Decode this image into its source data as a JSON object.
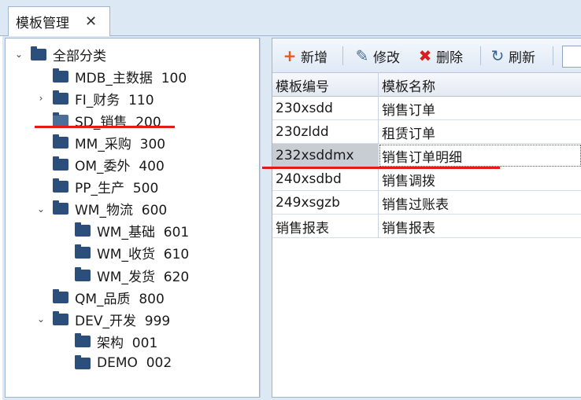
{
  "tab": {
    "label": "模板管理",
    "close": "✕"
  },
  "tree": [
    {
      "label": "全部分类",
      "level": 0,
      "arrow": "⌄",
      "open": false
    },
    {
      "label": "MDB_主数据  100",
      "level": 1,
      "arrow": "",
      "open": false
    },
    {
      "label": "FI_财务  110",
      "level": 1,
      "arrow": "›",
      "open": false
    },
    {
      "label": "SD_销售  200",
      "level": 1,
      "arrow": "",
      "open": true
    },
    {
      "label": "MM_采购  300",
      "level": 1,
      "arrow": "",
      "open": false
    },
    {
      "label": "OM_委外  400",
      "level": 1,
      "arrow": "",
      "open": false
    },
    {
      "label": "PP_生产  500",
      "level": 1,
      "arrow": "",
      "open": false
    },
    {
      "label": "WM_物流  600",
      "level": 1,
      "arrow": "⌄",
      "open": false
    },
    {
      "label": "WM_基础  601",
      "level": 2,
      "arrow": "",
      "open": false
    },
    {
      "label": "WM_收货  610",
      "level": 2,
      "arrow": "",
      "open": false
    },
    {
      "label": "WM_发货  620",
      "level": 2,
      "arrow": "",
      "open": false
    },
    {
      "label": "QM_品质  800",
      "level": 1,
      "arrow": "",
      "open": false
    },
    {
      "label": "DEV_开发  999",
      "level": 1,
      "arrow": "⌄",
      "open": false
    },
    {
      "label": "架构  001",
      "level": 2,
      "arrow": "",
      "open": false
    },
    {
      "label": "DEMO  002",
      "level": 2,
      "arrow": "",
      "open": false
    }
  ],
  "toolbar": {
    "add": "新增",
    "add_icon": "+",
    "edit": "修改",
    "edit_icon": "✎",
    "delete": "删除",
    "delete_icon": "✖",
    "refresh": "刷新",
    "refresh_icon": "↻"
  },
  "grid": {
    "columns": [
      "模板编号",
      "模板名称"
    ],
    "rows": [
      [
        "230xsdd",
        "销售订单"
      ],
      [
        "230zldd",
        "租赁订单"
      ],
      [
        "232xsddmx",
        "销售订单明细"
      ],
      [
        "240xsdbd",
        "销售调拨"
      ],
      [
        "249xsgzb",
        "销售过账表"
      ],
      [
        "销售报表",
        "销售报表"
      ]
    ],
    "selected_row": 2
  },
  "colors": {
    "accent_red": "#e41a1a",
    "folder": "#2b4f7a",
    "panel_bg": "#dde8f5"
  }
}
